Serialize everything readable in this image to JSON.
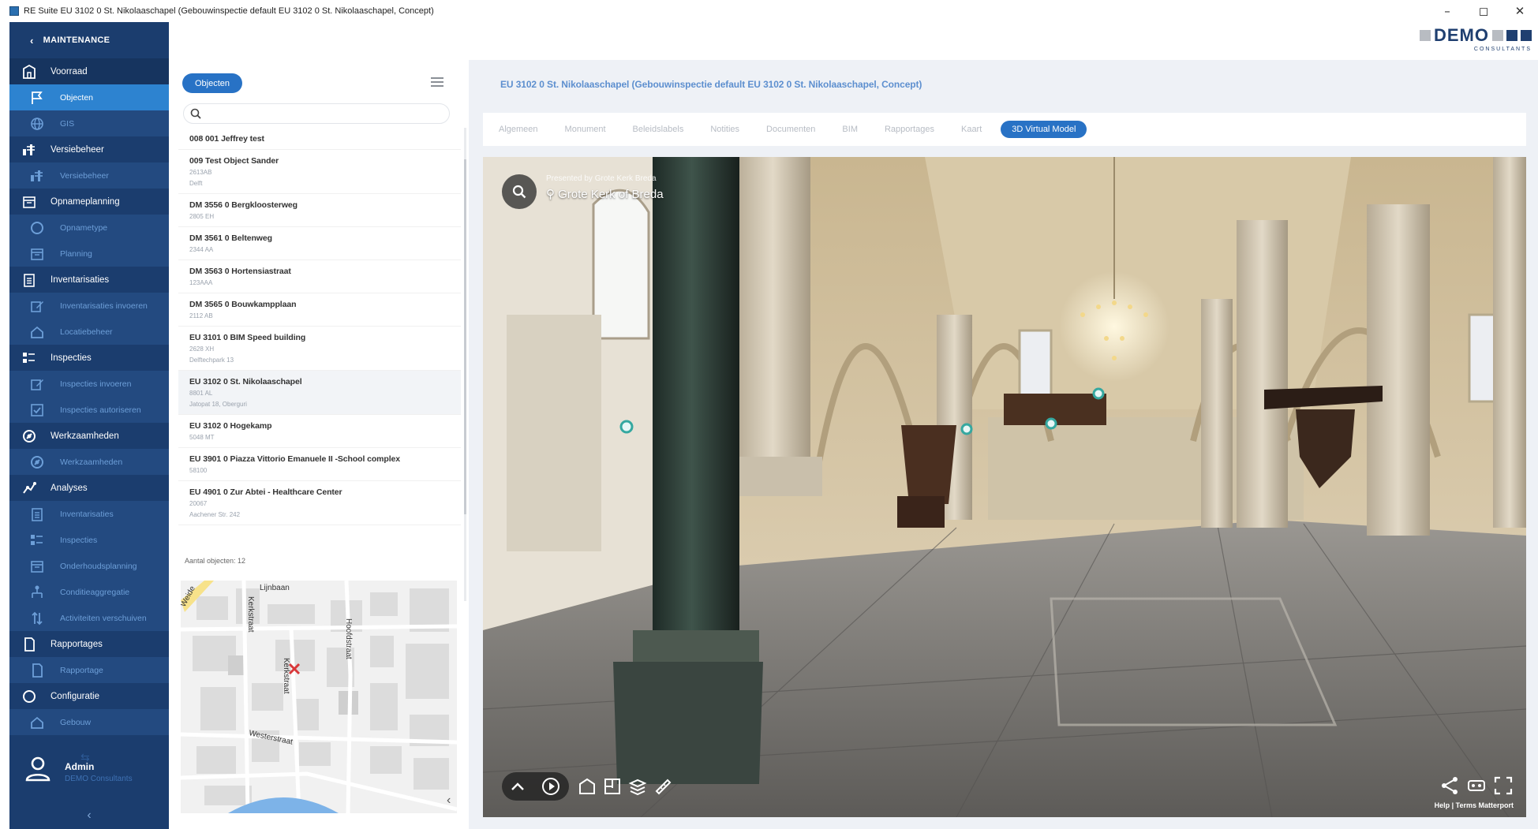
{
  "window": {
    "title": "RE Suite  EU 3102 0 St. Nikolaaschapel (Gebouwinspectie default EU 3102 0 St. Nikolaaschapel, Concept)",
    "controls": {
      "minimize": "–",
      "maximize": "◻",
      "close": "✕"
    }
  },
  "logo": {
    "text": "DEMO",
    "sub": "CONSULTANTS"
  },
  "sidebar": {
    "header": "MAINTENANCE",
    "items": [
      {
        "label": "Voorraad",
        "icon": "building-icon",
        "type": "group"
      },
      {
        "label": "Objecten",
        "icon": "flag-icon",
        "type": "sub",
        "active": true
      },
      {
        "label": "GIS",
        "icon": "globe-icon",
        "type": "sub"
      },
      {
        "label": "Versiebeheer",
        "icon": "version-icon",
        "type": "group"
      },
      {
        "label": "Versiebeheer",
        "icon": "version-icon",
        "type": "sub"
      },
      {
        "label": "Opnameplanning",
        "icon": "calendar-icon",
        "type": "group"
      },
      {
        "label": "Opnametype",
        "icon": "circle-icon",
        "type": "sub"
      },
      {
        "label": "Planning",
        "icon": "calendar-icon",
        "type": "sub"
      },
      {
        "label": "Inventarisaties",
        "icon": "clipboard-icon",
        "type": "group"
      },
      {
        "label": "Inventarisaties invoeren",
        "icon": "edit-icon",
        "type": "sub"
      },
      {
        "label": "Locatiebeheer",
        "icon": "home-icon",
        "type": "sub"
      },
      {
        "label": "Inspecties",
        "icon": "checklist-icon",
        "type": "group"
      },
      {
        "label": "Inspecties invoeren",
        "icon": "edit-icon",
        "type": "sub"
      },
      {
        "label": "Inspecties autoriseren",
        "icon": "approve-icon",
        "type": "sub"
      },
      {
        "label": "Werkzaamheden",
        "icon": "tools-icon",
        "type": "group"
      },
      {
        "label": "Werkzaamheden",
        "icon": "tools-icon",
        "type": "sub"
      },
      {
        "label": "Analyses",
        "icon": "analytics-icon",
        "type": "group"
      },
      {
        "label": "Inventarisaties",
        "icon": "clipboard-icon",
        "type": "sub"
      },
      {
        "label": "Inspecties",
        "icon": "checklist-icon",
        "type": "sub"
      },
      {
        "label": "Onderhoudsplanning",
        "icon": "calendar-icon",
        "type": "sub"
      },
      {
        "label": "Conditieaggregatie",
        "icon": "hierarchy-icon",
        "type": "sub"
      },
      {
        "label": "Activiteiten verschuiven",
        "icon": "shift-icon",
        "type": "sub"
      },
      {
        "label": "Rapportages",
        "icon": "report-icon",
        "type": "group"
      },
      {
        "label": "Rapportage",
        "icon": "report-icon",
        "type": "sub"
      },
      {
        "label": "Configuratie",
        "icon": "circle-icon",
        "type": "group"
      },
      {
        "label": "Gebouw",
        "icon": "home-icon",
        "type": "sub"
      }
    ],
    "user": {
      "name": "Admin",
      "company": "DEMO Consultants"
    }
  },
  "objects_panel": {
    "button": "Objecten",
    "search_placeholder": "",
    "items": [
      {
        "title": "008 001 Jeffrey test",
        "sub": []
      },
      {
        "title": "009  Test Object Sander",
        "sub": [
          "2613AB",
          "Delft"
        ]
      },
      {
        "title": "DM 3556 0 Bergkloosterweg",
        "sub": [
          "2805 EH"
        ]
      },
      {
        "title": "DM 3561 0 Beltenweg",
        "sub": [
          "2344 AA"
        ]
      },
      {
        "title": "DM 3563 0 Hortensiastraat",
        "sub": [
          "123AAA"
        ]
      },
      {
        "title": "DM 3565 0 Bouwkampplaan",
        "sub": [
          "2112 AB"
        ]
      },
      {
        "title": "EU 3101 0 BIM Speed building",
        "sub": [
          "2628 XH",
          "Delftechpark 13"
        ]
      },
      {
        "title": "EU 3102 0 St. Nikolaaschapel",
        "sub": [
          "8801 AL",
          "Jatopat 18, Oberguri"
        ],
        "selected": true
      },
      {
        "title": "EU 3102 0 Hogekamp",
        "sub": [
          "5048 MT"
        ]
      },
      {
        "title": "EU 3901 0 Piazza Vittorio Emanuele II -School complex",
        "sub": [
          "58100"
        ]
      },
      {
        "title": "EU 4901 0 Zur Abtei - Healthcare Center",
        "sub": [
          "20067",
          "Aachener Str. 242"
        ]
      }
    ],
    "count_label": "Aantal objecten: 12",
    "map": {
      "streets": [
        "Lijnbaan",
        "Kerkstraat",
        "Hoofdstraat",
        "Kerkstraat",
        "Westerstraat",
        "Weide"
      ]
    }
  },
  "main": {
    "breadcrumb": "EU 3102 0 St. Nikolaaschapel (Gebouwinspectie default EU 3102 0 St. Nikolaaschapel, Concept)",
    "tabs": [
      {
        "label": "Algemeen"
      },
      {
        "label": "Monument"
      },
      {
        "label": "Beleidslabels"
      },
      {
        "label": "Notities"
      },
      {
        "label": "Documenten"
      },
      {
        "label": "BIM"
      },
      {
        "label": "Rapportages"
      },
      {
        "label": "Kaart"
      },
      {
        "label": "3D Virtual Model",
        "active": true
      }
    ],
    "viewer": {
      "presented_by": "Presented by Grote Kerk Breda",
      "place_name": "Grote Kerk of Breda",
      "footer": "Help  |  Terms   Matterport"
    }
  },
  "colors": {
    "sidebar": "#1b3d6e",
    "sidebar_sub": "#234a80",
    "accent": "#2872c5",
    "active_sub": "#2d83d0"
  }
}
